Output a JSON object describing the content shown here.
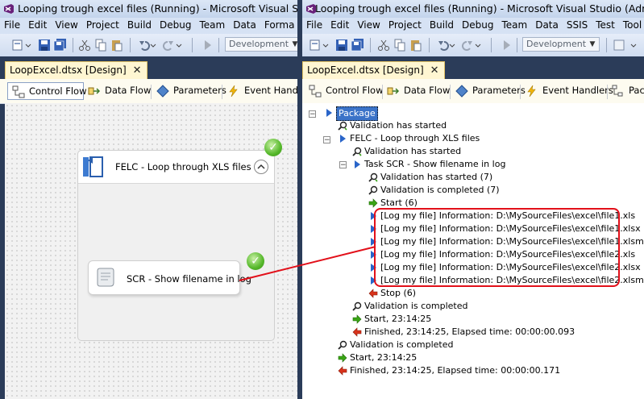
{
  "left_window": {
    "title": "Looping trough excel files (Running) - Microsoft Visual Studio (A",
    "menu": [
      "File",
      "Edit",
      "View",
      "Project",
      "Build",
      "Debug",
      "Team",
      "Data",
      "Forma"
    ],
    "config_combo": "Development",
    "doc_tab": "LoopExcel.dtsx [Design]",
    "design_tabs": [
      "Control Flow",
      "Data Flow",
      "Parameters",
      "Event Handle"
    ],
    "container_label": "FELC - Loop through XLS files",
    "task_label": "SCR - Show filename in log"
  },
  "right_window": {
    "title": "Looping trough excel files (Running) - Microsoft Visual Studio (Administrator",
    "menu": [
      "File",
      "Edit",
      "View",
      "Project",
      "Build",
      "Debug",
      "Team",
      "Data",
      "SSIS",
      "Test",
      "Tool"
    ],
    "config_combo": "Development",
    "doc_tab": "LoopExcel.dtsx [Design]",
    "design_tabs": [
      "Control Flow",
      "Data Flow",
      "Parameters",
      "Event Handlers",
      "Pack"
    ],
    "progress": {
      "package": "Package",
      "l1": "Validation has started",
      "felc": "FELC - Loop through XLS files",
      "l3": "Validation has started",
      "task": "Task SCR - Show filename in log",
      "l5": "Validation has started (7)",
      "l6": "Validation is completed (7)",
      "start6": "Start (6)",
      "log1": "[Log my file] Information: D:\\MySourceFiles\\excel\\file1.xls",
      "log2": "[Log my file] Information: D:\\MySourceFiles\\excel\\file1.xlsx",
      "log3": "[Log my file] Information: D:\\MySourceFiles\\excel\\file1.xlsm",
      "log4": "[Log my file] Information: D:\\MySourceFiles\\excel\\file2.xls",
      "log5": "[Log my file] Information: D:\\MySourceFiles\\excel\\file2.xlsx",
      "log6": "[Log my file] Information: D:\\MySourceFiles\\excel\\file2.xlsm",
      "stop6": "Stop (6)",
      "l13": "Validation is completed",
      "l14": "Start, 23:14:25",
      "l15": "Finished, 23:14:25, Elapsed time: 00:00:00.093",
      "l16": "Validation is completed",
      "l17": "Start, 23:14:25",
      "l18": "Finished, 23:14:25, Elapsed time: 00:00:00.171"
    }
  },
  "colors": {
    "annotation_red": "#e2101a",
    "success_green": "#55b82a",
    "vs_frame": "#2b3c59"
  }
}
